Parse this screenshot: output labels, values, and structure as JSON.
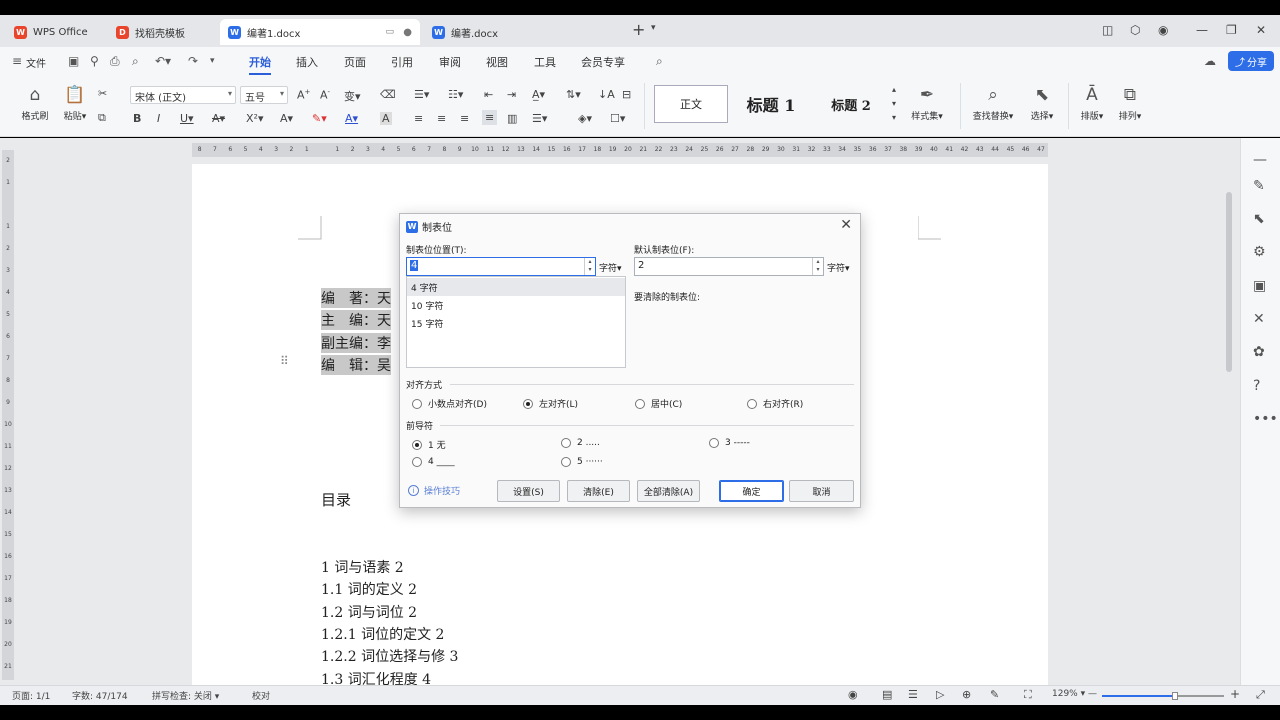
{
  "tabs": [
    {
      "label": "WPS Office",
      "logo_color": "#e8452c",
      "logo": "W"
    },
    {
      "label": "找稻壳模板",
      "logo_color": "#e8452c",
      "logo": "D"
    },
    {
      "label": "编著1.docx",
      "logo_color": "#2d6ee8",
      "logo": "W"
    },
    {
      "label": "编著.docx",
      "logo_color": "#2d6ee8",
      "logo": "W"
    }
  ],
  "menu": {
    "file": "文件",
    "items": [
      "开始",
      "插入",
      "页面",
      "引用",
      "审阅",
      "视图",
      "工具",
      "会员专享"
    ],
    "share": "分享"
  },
  "ribbon": {
    "format_painter": "格式刷",
    "paste": "粘贴",
    "font_name": "宋体 (正文)",
    "font_size": "五号",
    "styles": [
      "正文",
      "标题 1",
      "标题 2"
    ],
    "style_set": "样式集",
    "find_replace": "查找替换",
    "select": "选择",
    "layout": "排版",
    "arrange": "排列"
  },
  "ruler_h": [
    "8",
    "7",
    "6",
    "5",
    "4",
    "3",
    "2",
    "1",
    "",
    "1",
    "2",
    "3",
    "4",
    "5",
    "6",
    "7",
    "8",
    "9",
    "10",
    "11",
    "12",
    "13",
    "14",
    "15",
    "16",
    "17",
    "18",
    "19",
    "20",
    "21",
    "22",
    "23",
    "24",
    "25",
    "26",
    "27",
    "28",
    "29",
    "30",
    "31",
    "32",
    "33",
    "34",
    "35",
    "36",
    "37",
    "38",
    "39",
    "40",
    "41",
    "42",
    "43",
    "44",
    "45",
    "46",
    "47"
  ],
  "ruler_v": [
    "2",
    "1",
    "",
    "1",
    "2",
    "3",
    "4",
    "5",
    "6",
    "7",
    "8",
    "9",
    "10",
    "11",
    "12",
    "13",
    "14",
    "15",
    "16",
    "17",
    "18",
    "19",
    "20",
    "21"
  ],
  "document": {
    "credits": [
      "编　著：天",
      "主　编：天",
      "副主编：李",
      "编　辑：吴"
    ],
    "toc_title": "目录",
    "toc": [
      "1 词与语素 2",
      "1.1 词的定义 2",
      "1.2 词与词位 2",
      "1.2.1 词位的定文 2",
      "1.2.2 词位选择与修 3",
      "1.3 词汇化程度 4"
    ]
  },
  "dialog": {
    "title": "制表位",
    "tab_position_label": "制表位位置(T):",
    "tab_position_value": "4",
    "tab_unit": "字符",
    "default_tab_label": "默认制表位(F):",
    "default_tab_value": "2",
    "default_unit": "字符",
    "tab_list": [
      "4 字符",
      "10 字符",
      "15 字符"
    ],
    "clear_label": "要清除的制表位:",
    "alignment_label": "对齐方式",
    "alignment": [
      {
        "label": "小数点对齐(D)",
        "checked": false
      },
      {
        "label": "左对齐(L)",
        "checked": true
      },
      {
        "label": "居中(C)",
        "checked": false
      },
      {
        "label": "右对齐(R)",
        "checked": false
      }
    ],
    "leader_label": "前导符",
    "leaders": [
      {
        "label": "1 无",
        "checked": true
      },
      {
        "label": "2 .....",
        "checked": false
      },
      {
        "label": "3 -----",
        "checked": false
      },
      {
        "label": "4 ____",
        "checked": false
      },
      {
        "label": "5 ······",
        "checked": false
      }
    ],
    "tips": "操作技巧",
    "buttons": {
      "set": "设置(S)",
      "clear": "清除(E)",
      "clear_all": "全部清除(A)",
      "ok": "确定",
      "cancel": "取消"
    }
  },
  "status": {
    "page": "页面: 1/1",
    "words": "字数: 47/174",
    "spell": "拼写检查: 关闭",
    "proof": "校对",
    "zoom": "129%",
    "zoom_fraction": 0.6
  }
}
